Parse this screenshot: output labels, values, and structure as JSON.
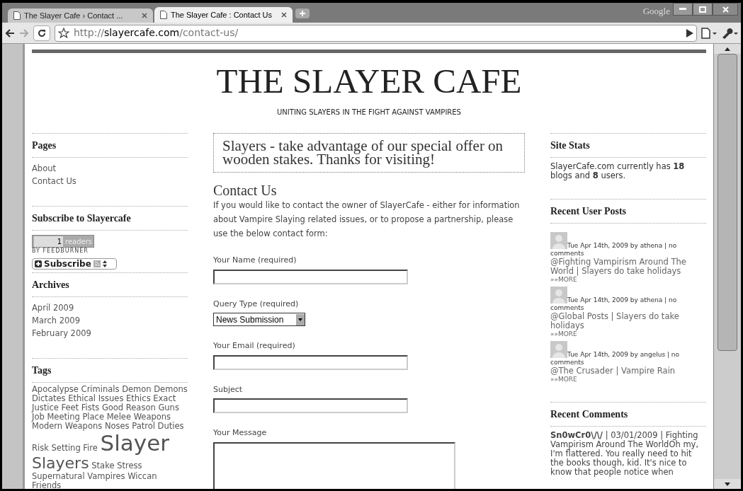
{
  "browser": {
    "brand": "Google",
    "tabs": [
      {
        "title": "The Slayer Cafe › Contact ...",
        "selected": false
      },
      {
        "title": "The Slayer Cafe : Contact Us",
        "selected": true
      }
    ],
    "url": {
      "scheme": "http://",
      "host": "slayercafe.com",
      "path": "/contact-us/"
    }
  },
  "site": {
    "title": "THE SLAYER CAFE",
    "tagline": "UNITING SLAYERS IN THE FIGHT AGAINST VAMPIRES"
  },
  "left": {
    "pages": {
      "heading": "Pages",
      "items": [
        "About",
        "Contact Us"
      ]
    },
    "subscribe": {
      "heading": "Subscribe to Slayercafe",
      "count": "1",
      "count_label": "readers",
      "byline": "BY FEEDBURNER",
      "button": "Subscribe"
    },
    "archives": {
      "heading": "Archives",
      "items": [
        "April 2009",
        "March 2009",
        "February 2009"
      ]
    },
    "tags": {
      "heading": "Tags",
      "items": [
        {
          "label": "Apocalypse",
          "kind": "normal"
        },
        {
          "label": "Criminals",
          "kind": "normal"
        },
        {
          "label": "Demon",
          "kind": "normal"
        },
        {
          "label": "Demons",
          "kind": "normal"
        },
        {
          "label": "Dictates",
          "kind": "normal"
        },
        {
          "label": "Ethical Issues",
          "kind": "normal"
        },
        {
          "label": "Ethics",
          "kind": "normal"
        },
        {
          "label": "Exact",
          "kind": "normal"
        },
        {
          "label": "Justice",
          "kind": "normal"
        },
        {
          "label": "Feet",
          "kind": "normal"
        },
        {
          "label": "Fists",
          "kind": "normal"
        },
        {
          "label": "Good Reason",
          "kind": "normal"
        },
        {
          "label": "Guns",
          "kind": "normal"
        },
        {
          "label": "Job",
          "kind": "normal"
        },
        {
          "label": "Meeting Place",
          "kind": "normal"
        },
        {
          "label": "Melee Weapons",
          "kind": "normal"
        },
        {
          "label": "Modern Weapons",
          "kind": "normal"
        },
        {
          "label": "Noses",
          "kind": "normal"
        },
        {
          "label": "Patrol Duties",
          "kind": "normal"
        },
        {
          "label": "Risk",
          "kind": "normal"
        },
        {
          "label": "Setting Fire",
          "kind": "normal"
        },
        {
          "label": "Slayer",
          "kind": "largest"
        },
        {
          "label": "Slayers",
          "kind": "large"
        },
        {
          "label": "Stake",
          "kind": "normal"
        },
        {
          "label": "Stress",
          "kind": "normal"
        },
        {
          "label": "Supernatural",
          "kind": "normal"
        },
        {
          "label": "Vampires",
          "kind": "normal"
        },
        {
          "label": "Wiccan",
          "kind": "normal"
        },
        {
          "label": "Friends",
          "kind": "normal"
        }
      ]
    }
  },
  "main": {
    "notice": "Slayers - take advantage of our special offer on wooden stakes. Thanks for visiting!",
    "heading": "Contact Us",
    "intro": "If you would like to contact the owner of SlayerCafe - either for information about Vampire Slaying related issues, or to propose a partnership, please use the below contact form:",
    "fields": [
      {
        "kind": "text",
        "label": "Your Name (required)"
      },
      {
        "kind": "select",
        "label": "Query Type (required)",
        "value": "News Submission"
      },
      {
        "kind": "text",
        "label": "Your Email (required)"
      },
      {
        "kind": "text",
        "label": "Subject"
      },
      {
        "kind": "textarea",
        "label": "Your Message"
      }
    ]
  },
  "right": {
    "stats": {
      "heading": "Site Stats",
      "text": "SlayerCafe.com currently has **18** blogs and **8** users."
    },
    "posts": {
      "heading": "Recent User Posts",
      "items": [
        {
          "meta": "Tue Apr 14th, 2009 by athena | no comments",
          "links": "@Fighting Vampirism Around The World | Slayers do take holidays",
          "more": "»»MORE"
        },
        {
          "meta": "Tue Apr 14th, 2009 by athena | no comments",
          "links": "@Global Posts | Slayers do take holidays",
          "more": "»»MORE"
        },
        {
          "meta": "Tue Apr 14th, 2009 by angelus | no comments",
          "links": "@The Crusader | Vampire Rain",
          "more": "»»MORE"
        }
      ]
    },
    "comments": {
      "heading": "Recent Comments",
      "items": [
        {
          "text": "**Sn0wCr0\\/\\/** | 03/01/2009 | Fighting Vampirism Around The WorldOh my, I'm flattered. You really need to hit the books though, kid. It's nice to know that people notice when"
        }
      ]
    }
  }
}
